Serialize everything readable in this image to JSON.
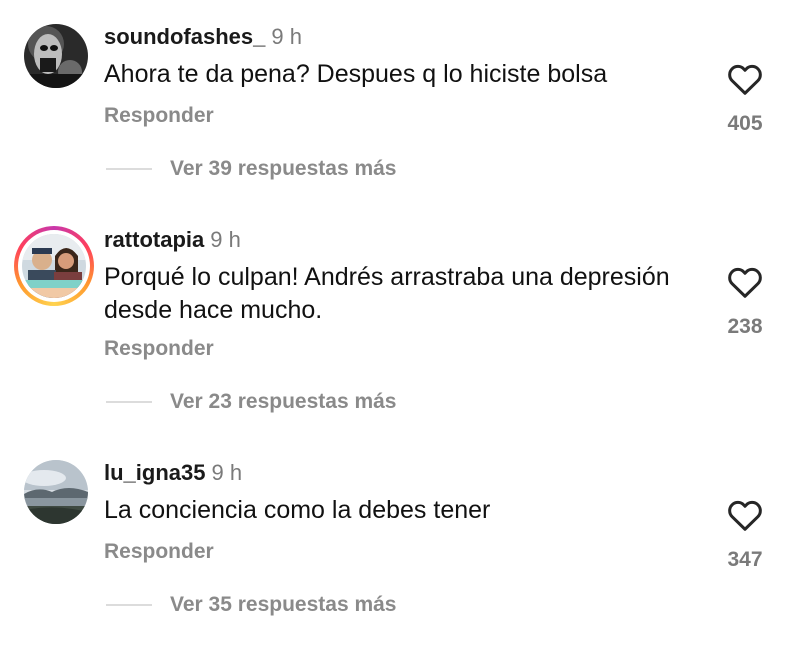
{
  "comments": [
    {
      "username": "soundofashes_",
      "time": "9 h",
      "text": "Ahora te da pena? Despues q lo hiciste bolsa",
      "reply_label": "Responder",
      "likes": "405",
      "view_replies": "Ver 39 respuestas más"
    },
    {
      "username": "rattotapia",
      "time": "9 h",
      "text": "Porqué lo culpan! Andrés arrastraba una depresión desde hace mucho.",
      "reply_label": "Responder",
      "likes": "238",
      "view_replies": "Ver 23 respuestas más"
    },
    {
      "username": "lu_igna35",
      "time": "9 h",
      "text": "La conciencia como la debes tener",
      "reply_label": "Responder",
      "likes": "347",
      "view_replies": "Ver 35 respuestas más"
    }
  ],
  "icons": {
    "like": "heart-outline-icon"
  },
  "colors": {
    "username": "#1a1a1a",
    "secondary_text": "#8a8a8a",
    "story_ring": [
      "#c837ab",
      "#ff3f5c",
      "#ff9a2e",
      "#ffd34f"
    ]
  }
}
